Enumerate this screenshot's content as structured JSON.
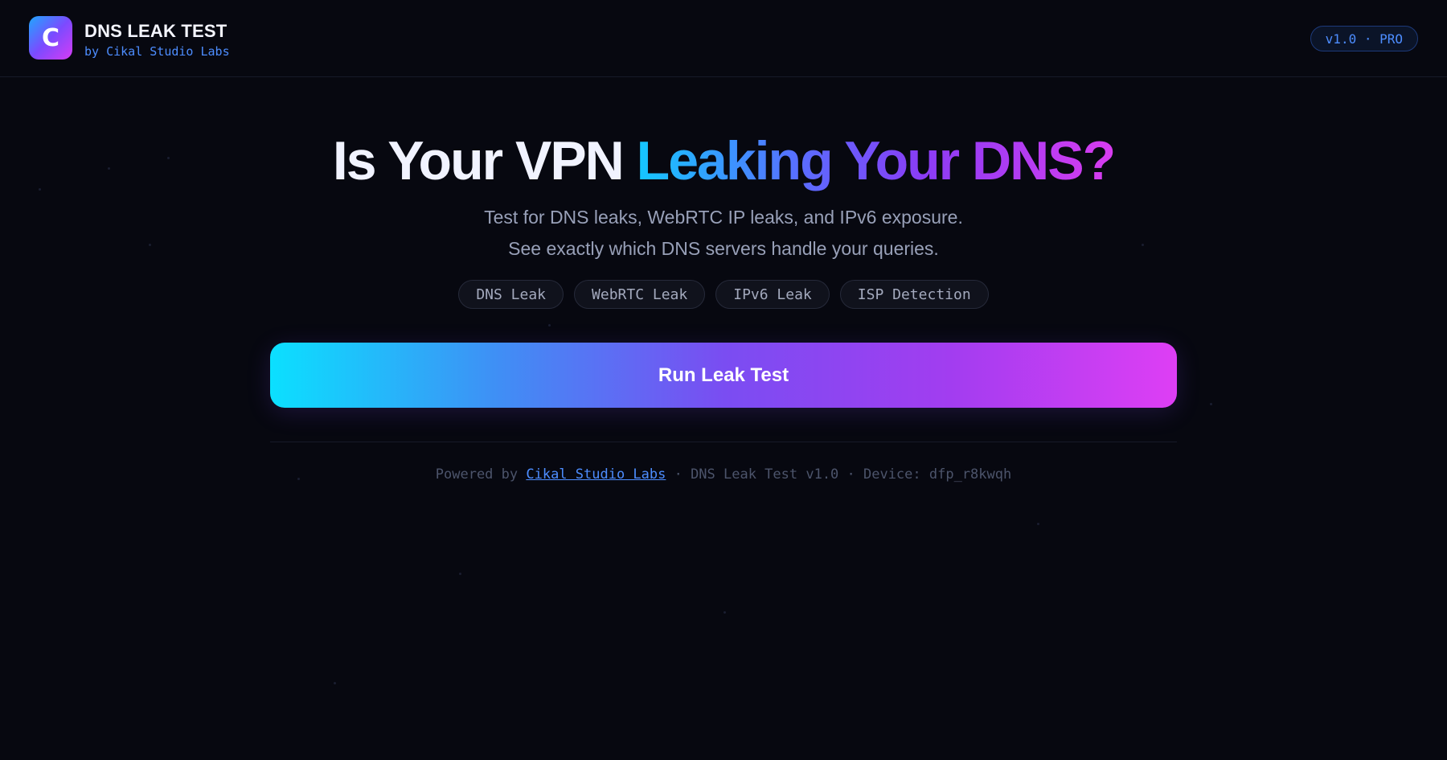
{
  "header": {
    "logo_letter": "C",
    "title": "DNS LEAK TEST",
    "subtitle": "by Cikal Studio Labs",
    "version_badge": "v1.0 · PRO"
  },
  "hero": {
    "title_plain": "Is Your VPN ",
    "title_gradient": "Leaking Your DNS?",
    "subtitle_line1": "Test for DNS leaks, WebRTC IP leaks, and IPv6 exposure.",
    "subtitle_line2": "See exactly which DNS servers handle your queries."
  },
  "tags": [
    "DNS Leak",
    "WebRTC Leak",
    "IPv6 Leak",
    "ISP Detection"
  ],
  "run_button_label": "Run Leak Test",
  "footer": {
    "powered_by": "Powered by ",
    "link_text": "Cikal Studio Labs",
    "rest": " · DNS Leak Test v1.0 · Device: dfp_r8kwqh"
  },
  "colors": {
    "background": "#070810",
    "accent_blue": "#4d8dff",
    "gradient_start": "#0be0ff",
    "gradient_mid": "#7a4df2",
    "gradient_end": "#de3ef4"
  }
}
